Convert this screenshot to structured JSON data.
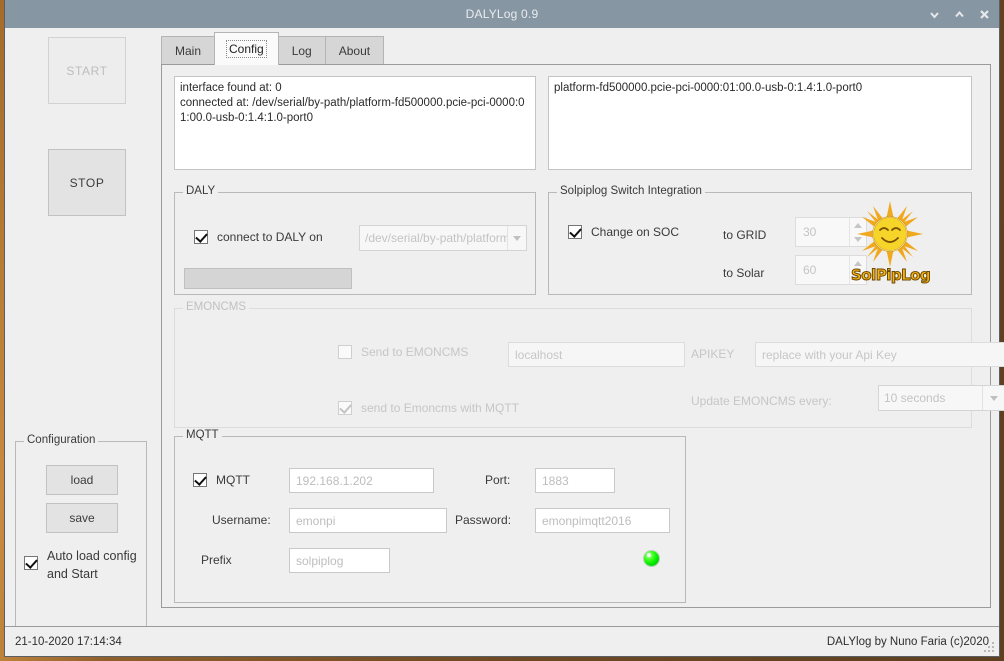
{
  "window": {
    "title": "DALYLog 0.9",
    "buttons": [
      {
        "name": "minimize-button",
        "icon": "chevron-down-icon"
      },
      {
        "name": "maximize-button",
        "icon": "chevron-up-icon"
      },
      {
        "name": "close-button",
        "icon": "close-icon"
      }
    ]
  },
  "sidebar": {
    "start_label": "START",
    "stop_label": "STOP",
    "status_led": "green",
    "configuration": {
      "legend": "Configuration",
      "load_label": "load",
      "save_label": "save",
      "autoload_label": "Auto load config and Start",
      "autoload_checked": true
    }
  },
  "tabs": [
    {
      "label": "Main",
      "active": false
    },
    {
      "label": "Config",
      "active": true
    },
    {
      "label": "Log",
      "active": false
    },
    {
      "label": "About",
      "active": false
    }
  ],
  "config": {
    "log_left": "interface found at: 0\nconnected at: /dev/serial/by-path/platform-fd500000.pcie-pci-0000:01:00.0-usb-0:1.4:1.0-port0",
    "log_right": "platform-fd500000.pcie-pci-0000:01:00.0-usb-0:1.4:1.0-port0",
    "daly": {
      "legend": "DALY",
      "connect_label": "connect to DALY on",
      "connect_checked": true,
      "port_value": "/dev/serial/by-path/platform-fd",
      "status_field": ""
    },
    "solpiplog": {
      "legend": "Solpiplog Switch Integration",
      "change_soc_label": "Change on SOC",
      "change_soc_checked": true,
      "to_grid_label": "to GRID",
      "to_grid_value": "30",
      "to_solar_label": "to Solar",
      "to_solar_value": "60",
      "logo_text": "SolPipLog"
    },
    "emoncms": {
      "legend": "EMONCMS",
      "send_label": "Send to EMONCMS",
      "send_checked": false,
      "host_value": "localhost",
      "apikey_label": "APIKEY",
      "apikey_placeholder": "replace with your Api Key",
      "mqtt_send_label": "send to Emoncms with MQTT",
      "mqtt_send_checked": true,
      "update_label": "Update EMONCMS every:",
      "update_value": "10 seconds"
    },
    "mqtt": {
      "legend": "MQTT",
      "enable_label": "MQTT",
      "enable_checked": true,
      "host_value": "192.168.1.202",
      "port_label": "Port:",
      "port_value": "1883",
      "username_label": "Username:",
      "username_value": "emonpi",
      "password_label": "Password:",
      "password_value": "emonpimqtt2016",
      "prefix_label": "Prefix",
      "prefix_value": "solpiplog",
      "status_led": "green"
    }
  },
  "statusbar": {
    "timestamp": "21-10-2020 17:14:34",
    "credit": "DALYlog by Nuno Faria (c)2020"
  },
  "colors": {
    "titlebar": "#8796a3",
    "led_green": "#00e500",
    "window_bg": "#efefef",
    "accent_orange": "#f5b214"
  }
}
